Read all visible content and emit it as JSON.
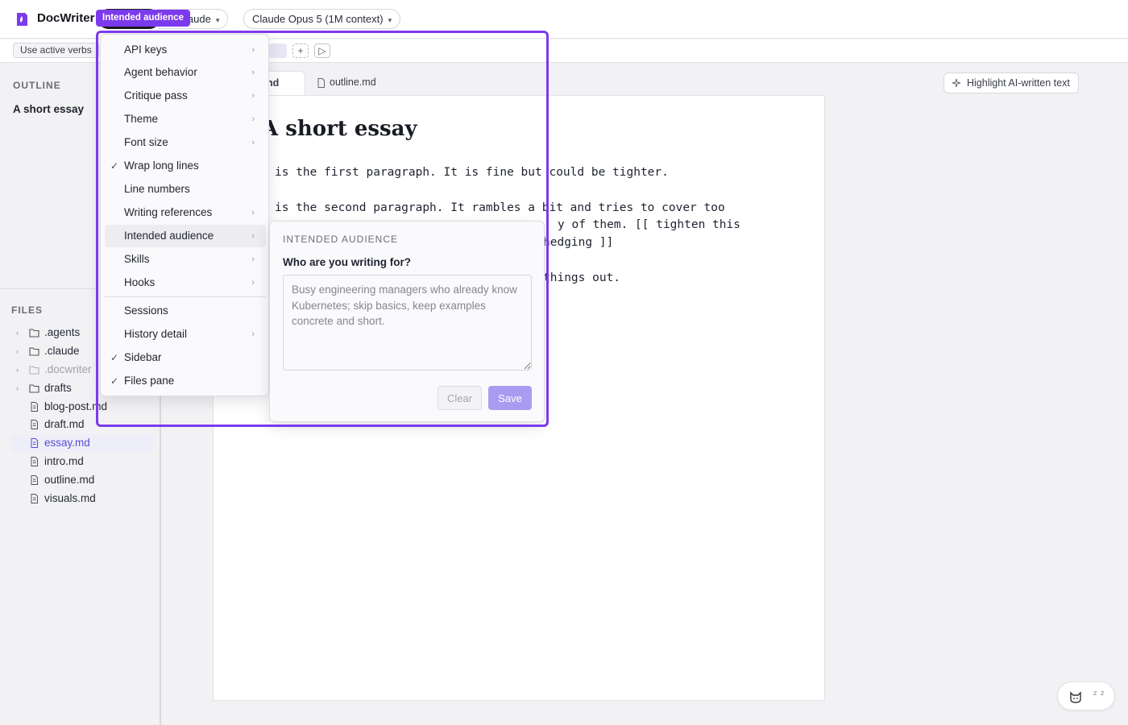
{
  "app": {
    "title": "DocWriter",
    "colors": {
      "accent": "#7c3aed",
      "save_button": "#a99cf0",
      "active_file": "#5b4bd6"
    }
  },
  "header": {
    "agent_pill": "laude",
    "model_pill": "Claude Opus 5 (1M context)",
    "tooltip": "Intended audience"
  },
  "toolbar": {
    "chip": "Use active verbs",
    "add_label": "+",
    "run_label": "▷"
  },
  "sidebar": {
    "outline_label": "OUTLINE",
    "outline_items": [
      "A short essay"
    ],
    "files_label": "FILES",
    "folders": [
      ".agents",
      ".claude",
      ".docwriter",
      "drafts"
    ],
    "files": [
      "blog-post.md",
      "draft.md",
      "essay.md",
      "intro.md",
      "outline.md",
      "visuals.md"
    ],
    "active_file": "essay.md"
  },
  "tabs": [
    {
      "label": "nd",
      "active": true
    },
    {
      "label": "outline.md",
      "active": false
    }
  ],
  "editor": {
    "highlight_button": "Highlight AI-written text",
    "title": "A short essay",
    "paragraphs": [
      "is the first paragraph. It is fine but could be tighter.",
      "is the second paragraph. It rambles a bit and tries to cover too",
      "y of them. [[ tighten this",
      "hedging ]]",
      "things out."
    ]
  },
  "menu": {
    "items": [
      {
        "label": "API keys",
        "submenu": true,
        "checked": false
      },
      {
        "label": "Agent behavior",
        "submenu": true,
        "checked": false
      },
      {
        "label": "Critique pass",
        "submenu": true,
        "checked": false
      },
      {
        "label": "Theme",
        "submenu": true,
        "checked": false
      },
      {
        "label": "Font size",
        "submenu": true,
        "checked": false
      },
      {
        "label": "Wrap long lines",
        "submenu": false,
        "checked": true
      },
      {
        "label": "Line numbers",
        "submenu": false,
        "checked": false
      },
      {
        "label": "Writing references",
        "submenu": true,
        "checked": false
      },
      {
        "label": "Intended audience",
        "submenu": true,
        "checked": false,
        "active": true
      },
      {
        "label": "Skills",
        "submenu": true,
        "checked": false
      },
      {
        "label": "Hooks",
        "submenu": true,
        "checked": false
      },
      {
        "label": "Sessions",
        "submenu": false,
        "checked": false
      },
      {
        "label": "History detail",
        "submenu": true,
        "checked": false
      },
      {
        "label": "Sidebar",
        "submenu": false,
        "checked": true
      },
      {
        "label": "Files pane",
        "submenu": false,
        "checked": true
      }
    ]
  },
  "audience_panel": {
    "title": "INTENDED AUDIENCE",
    "question": "Who are you writing for?",
    "placeholder": "Busy engineering managers who already know Kubernetes; skip basics, keep examples concrete and short.",
    "value": "",
    "clear_label": "Clear",
    "save_label": "Save"
  },
  "status": {
    "sleep_label": "z z"
  }
}
